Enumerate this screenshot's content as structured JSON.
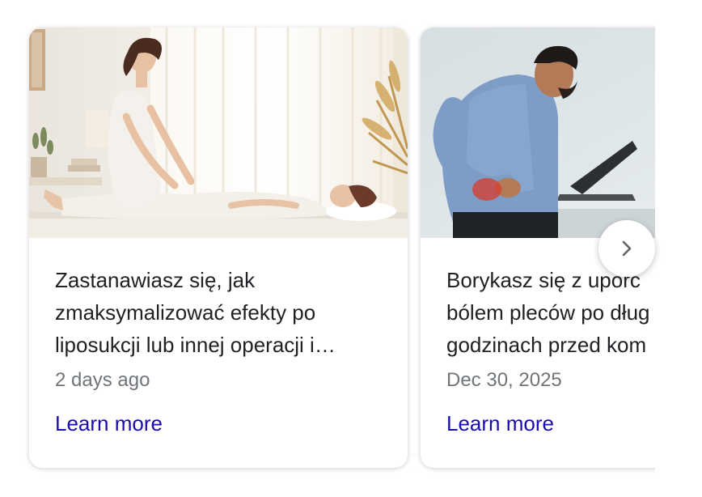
{
  "carousel": {
    "cards": [
      {
        "title": "Zastanawiasz się, jak zmaksymalizować efekty po liposukcji lub innej operacji i…",
        "date": "2 days ago",
        "link_label": "Learn more"
      },
      {
        "title_lines": [
          "Borykasz się z uporc",
          "bólem pleców po dług",
          "godzinach przed kom"
        ],
        "date": "Dec 30, 2025",
        "link_label": "Learn more"
      }
    ],
    "next_icon": "chevron-right-icon"
  },
  "colors": {
    "title": "#202124",
    "date": "#70757a",
    "link": "#1a0dab"
  }
}
